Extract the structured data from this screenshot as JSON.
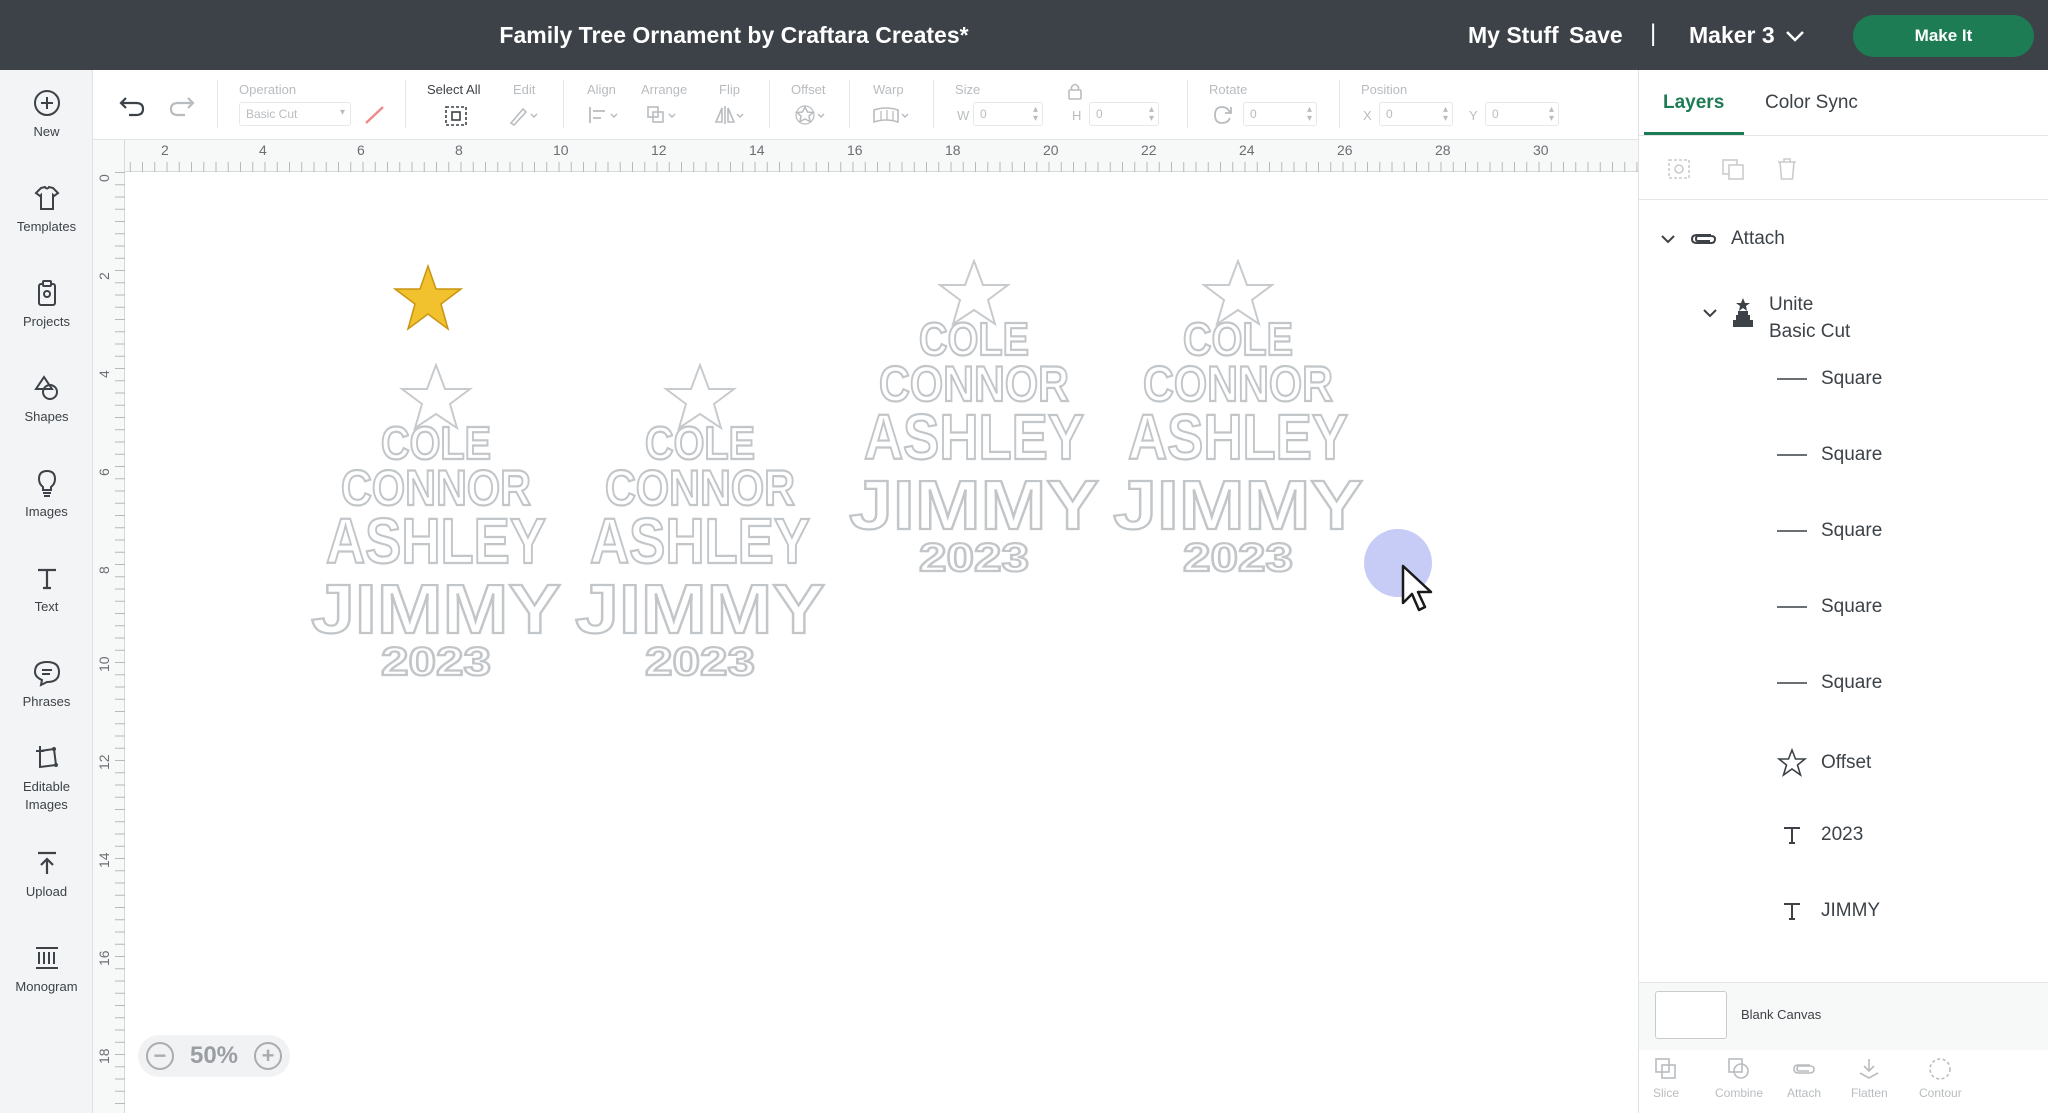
{
  "header": {
    "title": "Family Tree Ornament by Craftara Creates*",
    "my_stuff": "My Stuff",
    "save": "Save",
    "separator": "|",
    "machine": "Maker 3",
    "make_it": "Make It"
  },
  "sidebar": {
    "items": [
      {
        "label": "New",
        "icon": "plus-circle-icon"
      },
      {
        "label": "Templates",
        "icon": "shirt-icon"
      },
      {
        "label": "Projects",
        "icon": "clipboard-icon"
      },
      {
        "label": "Shapes",
        "icon": "shapes-icon"
      },
      {
        "label": "Images",
        "icon": "lightbulb-icon"
      },
      {
        "label": "Text",
        "icon": "text-t-icon"
      },
      {
        "label": "Phrases",
        "icon": "speech-bubble-icon"
      },
      {
        "label": "Editable",
        "label2": "Images",
        "icon": "editable-image-icon"
      },
      {
        "label": "Upload",
        "icon": "upload-icon"
      },
      {
        "label": "Monogram",
        "icon": "monogram-icon"
      }
    ]
  },
  "toolbar": {
    "operation_label": "Operation",
    "operation_value": "Basic Cut",
    "select_all": "Select All",
    "edit": "Edit",
    "align": "Align",
    "arrange": "Arrange",
    "flip": "Flip",
    "offset": "Offset",
    "warp": "Warp",
    "size": "Size",
    "size_w": "W",
    "size_w_value": "0",
    "size_h": "H",
    "size_h_value": "0",
    "rotate": "Rotate",
    "rotate_value": "0",
    "position": "Position",
    "pos_x": "X",
    "pos_x_value": "0",
    "pos_y": "Y",
    "pos_y_value": "0"
  },
  "ruler": {
    "top": [
      "2",
      "4",
      "6",
      "8",
      "10",
      "12",
      "14",
      "16",
      "18",
      "20",
      "22",
      "24",
      "26",
      "28",
      "30"
    ],
    "left": [
      "0",
      "2",
      "4",
      "6",
      "8",
      "10",
      "12",
      "14",
      "16",
      "18"
    ]
  },
  "canvas": {
    "ornament_lines": [
      "COLE",
      "CONNOR",
      "ASHLEY",
      "JIMMY",
      "2023"
    ],
    "zoom": "50%",
    "star_color": "#f2c12e"
  },
  "panel": {
    "tab_layers": "Layers",
    "tab_color_sync": "Color Sync",
    "layers": [
      {
        "label": "Attach",
        "icon": "attach-icon"
      },
      {
        "label": "Unite",
        "sub": "Basic Cut",
        "icon": "tree-ornament-icon"
      },
      {
        "label": "Square",
        "icon": "line-icon"
      },
      {
        "label": "Square",
        "icon": "line-icon"
      },
      {
        "label": "Square",
        "icon": "line-icon"
      },
      {
        "label": "Square",
        "icon": "line-icon"
      },
      {
        "label": "Square",
        "icon": "line-icon"
      },
      {
        "label": "Offset",
        "icon": "star-outline-icon"
      },
      {
        "label": "2023",
        "icon": "text-t-icon"
      },
      {
        "label": "JIMMY",
        "icon": "text-t-icon"
      }
    ],
    "blank_canvas": "Blank Canvas",
    "bottom_tools": [
      "Slice",
      "Combine",
      "Attach",
      "Flatten",
      "Contour"
    ]
  },
  "colors": {
    "header_bg": "#3c4247",
    "accent_green": "#1e7c55"
  }
}
